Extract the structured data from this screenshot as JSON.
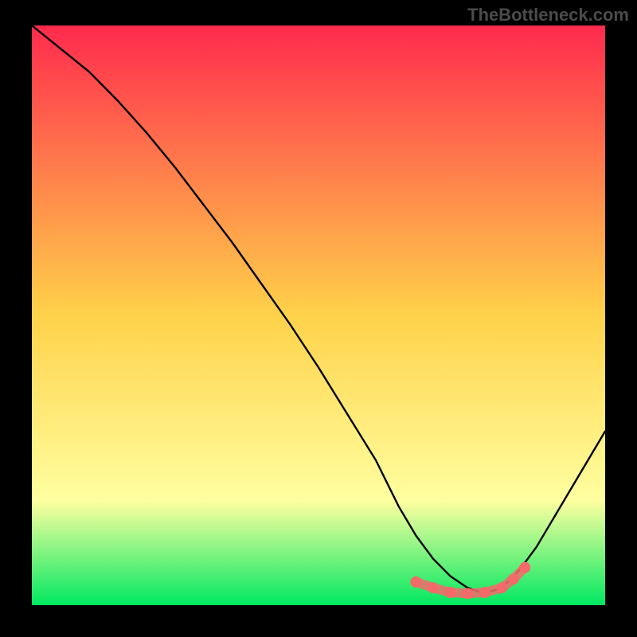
{
  "watermark": "TheBottleneck.com",
  "chart_data": {
    "type": "line",
    "title": "",
    "xlabel": "",
    "ylabel": "",
    "xlim": [
      0,
      100
    ],
    "ylim": [
      0,
      100
    ],
    "grid": false,
    "legend": false,
    "background_gradient": {
      "top_color": "#ff2a4d",
      "mid_color": "#ffd24a",
      "lower_mid_color": "#ffffa0",
      "bottom_color": "#00e861"
    },
    "series": [
      {
        "name": "bottleneck-curve",
        "stroke": "#000000",
        "x": [
          0,
          5,
          10,
          15,
          20,
          25,
          30,
          35,
          40,
          45,
          50,
          55,
          60,
          64,
          67,
          70,
          73,
          76,
          79,
          82,
          85,
          88,
          91,
          94,
          97,
          100
        ],
        "y": [
          100,
          96,
          92,
          87,
          81.5,
          75.5,
          69,
          62.5,
          55.5,
          48.5,
          41,
          33,
          25,
          17,
          12,
          8,
          5,
          3,
          2,
          3,
          6,
          10,
          15,
          20,
          25,
          30
        ]
      }
    ],
    "markers": {
      "name": "highlighted-range",
      "color": "#f46a6a",
      "points_x": [
        67,
        70,
        73,
        76,
        79,
        82,
        84,
        86
      ],
      "points_y": [
        4,
        3,
        2.2,
        2,
        2.2,
        3,
        4.5,
        6.5
      ]
    }
  }
}
